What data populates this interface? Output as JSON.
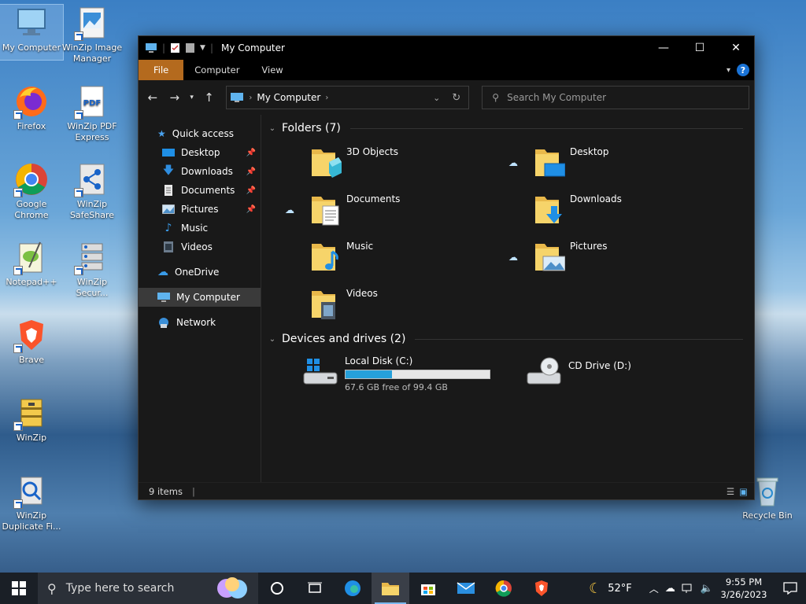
{
  "desktop": {
    "icons": [
      {
        "label": "My Computer"
      },
      {
        "label": "WinZip Image Manager"
      },
      {
        "label": "Firefox"
      },
      {
        "label": "WinZip PDF Express"
      },
      {
        "label": "Google Chrome"
      },
      {
        "label": "WinZip SafeShare"
      },
      {
        "label": "Notepad++"
      },
      {
        "label": "WinZip Secur..."
      },
      {
        "label": "Brave"
      },
      {
        "label": "WinZip"
      },
      {
        "label": "WinZip Duplicate Fi..."
      },
      {
        "label": "Recycle Bin"
      }
    ]
  },
  "window": {
    "title": "My Computer",
    "ribbon": {
      "tabs": [
        "File",
        "Computer",
        "View"
      ],
      "help": "?"
    },
    "address": {
      "location": "My Computer"
    },
    "search": {
      "placeholder": "Search My Computer"
    },
    "sidebar": {
      "items": [
        {
          "label": "Quick access"
        },
        {
          "label": "Desktop"
        },
        {
          "label": "Downloads"
        },
        {
          "label": "Documents"
        },
        {
          "label": "Pictures"
        },
        {
          "label": "Music"
        },
        {
          "label": "Videos"
        },
        {
          "label": "OneDrive"
        },
        {
          "label": "My Computer"
        },
        {
          "label": "Network"
        }
      ]
    },
    "folders_header": "Folders (7)",
    "folders": [
      {
        "name": "3D Objects"
      },
      {
        "name": "Desktop"
      },
      {
        "name": "Documents"
      },
      {
        "name": "Downloads"
      },
      {
        "name": "Music"
      },
      {
        "name": "Pictures"
      },
      {
        "name": "Videos"
      }
    ],
    "drives_header": "Devices and drives (2)",
    "drives": [
      {
        "name": "Local Disk (C:)",
        "free": "67.6 GB free of 99.4 GB",
        "used_fraction": 0.32
      },
      {
        "name": "CD Drive (D:)"
      }
    ],
    "status": {
      "items": "9 items"
    }
  },
  "taskbar": {
    "search_placeholder": "Type here to search",
    "weather": "52°F",
    "time": "9:55 PM",
    "date": "3/26/2023"
  },
  "colors": {
    "accent": "#26a0da",
    "file_tab": "#b46a1e",
    "taskbar": "#1a1f26"
  }
}
